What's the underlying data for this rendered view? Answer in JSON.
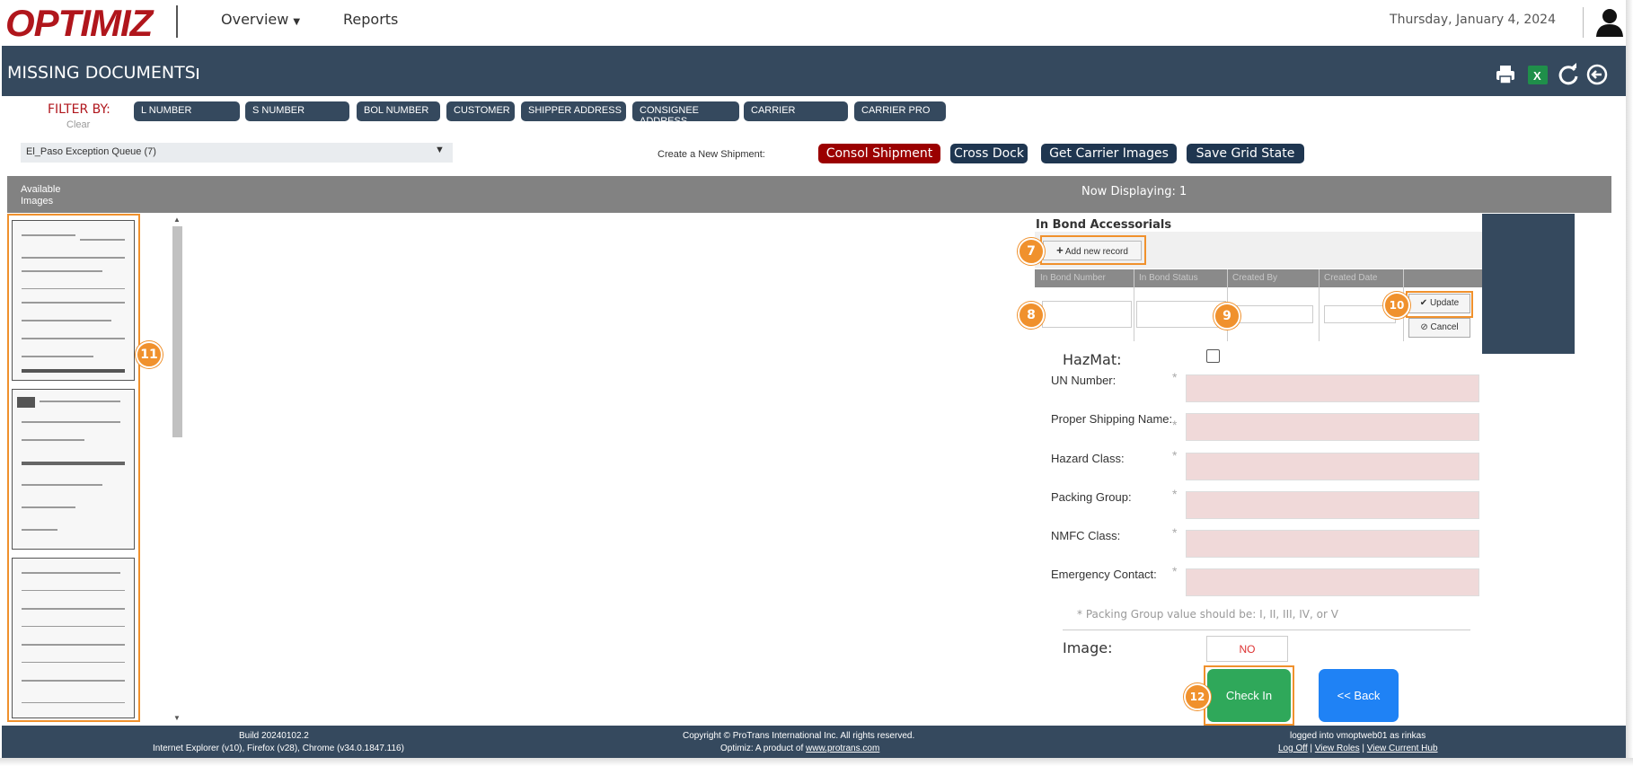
{
  "app": {
    "logo": "OPTIMIZ",
    "date": "Thursday, January 4, 2024"
  },
  "nav": {
    "overview": "Overview",
    "reports": "Reports"
  },
  "page": {
    "title": "MISSING DOCUMENTS"
  },
  "toolbar_icons": [
    "print-icon",
    "excel-icon",
    "refresh-icon",
    "back-arrow-icon"
  ],
  "filter": {
    "label": "FILTER BY:",
    "clear": "Clear",
    "pills": [
      "L NUMBER",
      "S NUMBER",
      "BOL NUMBER",
      "CUSTOMER",
      "SHIPPER ADDRESS",
      "CONSIGNEE ADDRESS",
      "CARRIER",
      "CARRIER PRO"
    ]
  },
  "queue": {
    "selected": "El_Paso Exception Queue (7)"
  },
  "create": {
    "label": "Create a New Shipment:",
    "consol": "Consol Shipment",
    "crossdock": "Cross Dock",
    "carrier_images": "Get Carrier Images",
    "save_grid": "Save Grid State"
  },
  "grid_header": {
    "available_images": "Available Images",
    "now_displaying": "Now Displaying: 1"
  },
  "inbond": {
    "title": "In Bond Accessorials",
    "add": "Add new record",
    "columns": [
      "In Bond Number",
      "In Bond Status",
      "Created By",
      "Created Date"
    ],
    "update": "Update",
    "cancel": "Cancel"
  },
  "hazmat": {
    "label": "HazMat:",
    "checked": false,
    "fields": [
      "UN Number:",
      "Proper Shipping Name:",
      "Hazard Class:",
      "Packing Group:",
      "NMFC Class:",
      "Emergency Contact:"
    ],
    "required_mark": "*",
    "note": "* Packing Group value should be: I, II, III, IV, or V"
  },
  "image": {
    "label": "Image:",
    "value": "NO"
  },
  "actions": {
    "check_in": "Check In",
    "back": "<< Back"
  },
  "callouts": {
    "c7": "7",
    "c8": "8",
    "c9": "9",
    "c10": "10",
    "c11": "11",
    "c12": "12"
  },
  "footer": {
    "build": "Build 20240102.2",
    "browsers": "Internet Explorer (v10), Firefox (v28), Chrome (v34.0.1847.116)",
    "copyright": "Copyright © ProTrans International Inc. All rights reserved.",
    "product_prefix": "Optimiz: A product of ",
    "product_link": "www.protrans.com",
    "logged": "logged into vmoptweb01 as rinkas",
    "links": [
      "Log Off",
      "View Roles",
      "View Current Hub"
    ]
  },
  "colors": {
    "navy": "#35495e",
    "brand_red": "#b0161c",
    "accent_red": "#9b0000",
    "highlight": "#f0912d",
    "green": "#2fa85a",
    "blue": "#1f82f5"
  }
}
